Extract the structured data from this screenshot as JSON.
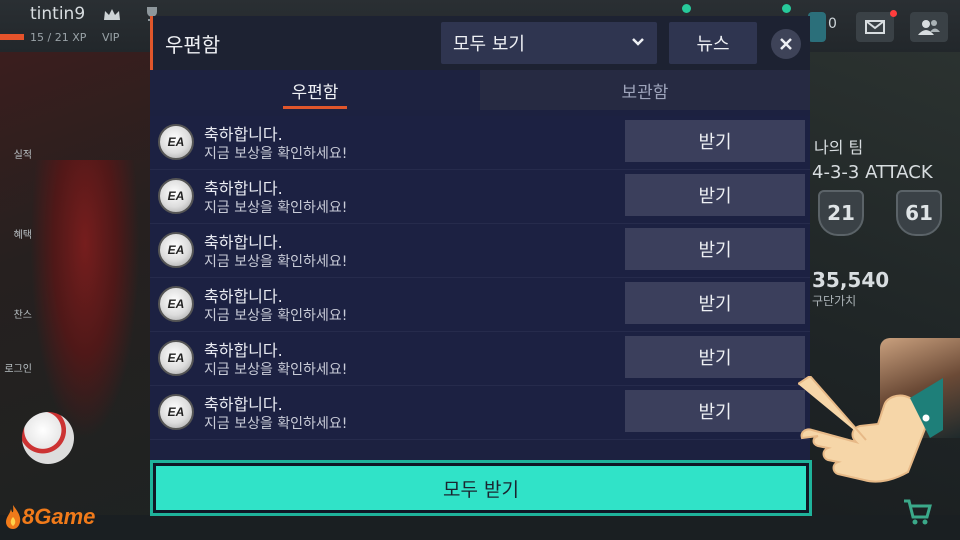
{
  "hud": {
    "username": "tintin9",
    "xp": "15 / 21 XP",
    "vip": "VIP",
    "coin_count": "0"
  },
  "background": {
    "side_menu": [
      "실적",
      "혜택",
      "찬스",
      "로그인"
    ],
    "team_title": "나의 팀",
    "formation": "4-3-3 ATTACK",
    "badge_left": "21",
    "badge_right": "61",
    "team_value": "35,540",
    "team_value_label": "구단가치"
  },
  "mailbox": {
    "title": "우편함",
    "filter": {
      "selected": "모두 보기",
      "icon": "chevron-down-icon"
    },
    "news_label": "뉴스",
    "close_icon": "close-icon",
    "tabs": [
      {
        "label": "우편함",
        "active": true
      },
      {
        "label": "보관함",
        "active": false
      }
    ],
    "messages": [
      {
        "sender_icon": "EA",
        "title": "축하합니다.",
        "description": "지금 보상을 확인하세요!",
        "action": "받기"
      },
      {
        "sender_icon": "EA",
        "title": "축하합니다.",
        "description": "지금 보상을 확인하세요!",
        "action": "받기"
      },
      {
        "sender_icon": "EA",
        "title": "축하합니다.",
        "description": "지금 보상을 확인하세요!",
        "action": "받기"
      },
      {
        "sender_icon": "EA",
        "title": "축하합니다.",
        "description": "지금 보상을 확인하세요!",
        "action": "받기"
      },
      {
        "sender_icon": "EA",
        "title": "축하합니다.",
        "description": "지금 보상을 확인하세요!",
        "action": "받기"
      },
      {
        "sender_icon": "EA",
        "title": "축하합니다.",
        "description": "지금 보상을 확인하세요!",
        "action": "받기"
      }
    ],
    "receive_all_label": "모두 받기"
  },
  "watermark": {
    "brand": "8Game"
  },
  "colors": {
    "accent_orange": "#e0562b",
    "receive_all_teal": "#30e3c8",
    "modal_bg": "#1c2140"
  }
}
